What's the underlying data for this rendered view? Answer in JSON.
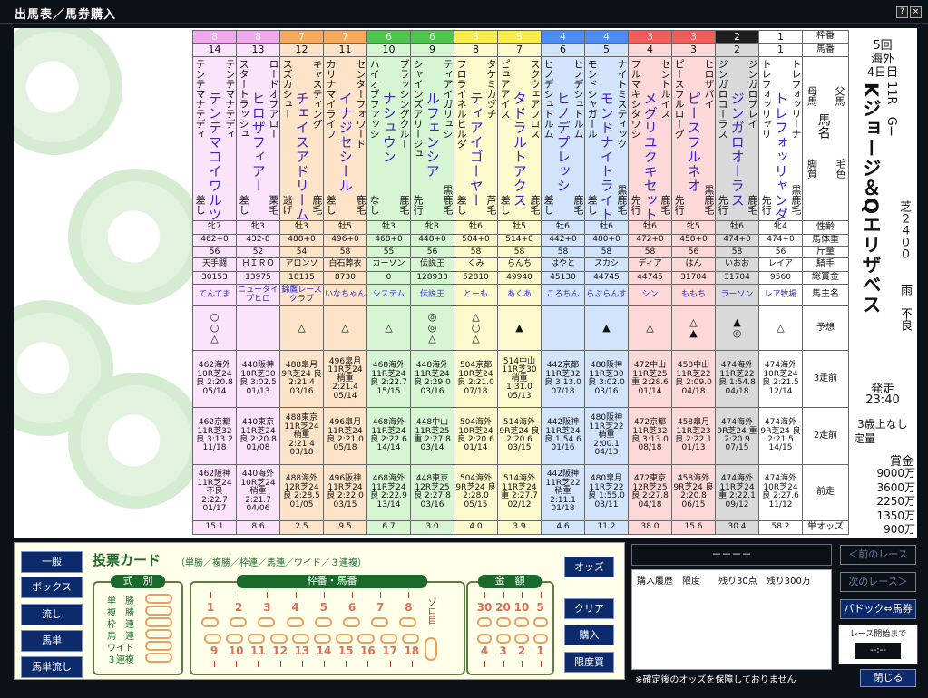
{
  "window": {
    "title": "出馬表／馬券購入",
    "help": "?",
    "close": "×"
  },
  "labels": {
    "waku": "枠番",
    "umaban": "馬番",
    "chichi": "父馬",
    "haha": "母馬",
    "bamei": "馬名",
    "kyakushitsu": "脚質",
    "keiro": "毛色",
    "seirei": "性齢",
    "bataiju": "馬体重",
    "kinryo": "斤量",
    "kishu": "騎手",
    "soushokin": "総賞金",
    "umanushi": "馬主名",
    "yoso": "予想",
    "s3": "3走前",
    "s2": "2走前",
    "s1": "前走",
    "odds": "単オッズ"
  },
  "horses": [
    {
      "waku": "8",
      "umaban": "14",
      "sire": "テンテマナテディ",
      "dam": "テンテマナテディ",
      "name": "テンテマコイワルツ",
      "style": "差し",
      "color": "",
      "sex": "牝7",
      "weight": "462+0",
      "kin": "56",
      "jockey": "天手闘",
      "prize": "30153",
      "owner": "てんてま",
      "m": "○\n○\n△",
      "r3": "462海外\n10R芝24\n良\n2:20.8\n05/14",
      "r2": "462京都\n11R芝32\n良\n3:13.2\n11/18",
      "r1": "462阪神\n11R芝24\n不良\n2:22.7\n01/17",
      "odds": "15.1"
    },
    {
      "waku": "8",
      "umaban": "13",
      "sire": "ロードオブアロー",
      "dam": "スタートラッシュ",
      "name": "ヒロザフィアー",
      "style": "差し",
      "color": "栗毛",
      "sex": "牝3",
      "weight": "432-8",
      "kin": "52",
      "jockey": "ＨＩＲＯ",
      "prize": "13975",
      "owner": "ニュータイプヒロ",
      "m": "",
      "r3": "440阪神\n10R芝30\n良\n3:02.5\n01/13",
      "r2": "440東京\n11R芝24\n良\n2:20.8\n01/08",
      "r1": "440海外\n10R芝24\n稍重\n2:21.7\n04/06",
      "odds": "8.6"
    },
    {
      "waku": "7",
      "umaban": "12",
      "sire": "キャスティング",
      "dam": "スズカシュー",
      "name": "チェイスアドリーム",
      "style": "逃げ",
      "color": "鹿毛",
      "sex": "牡3",
      "weight": "488+0",
      "kin": "54",
      "jockey": "アロンソ",
      "prize": "18115",
      "owner": "錦鷹レースクラブ",
      "m": "△",
      "r3": "488皐月\n9R芝24\n良\n2:21.4\n03/16",
      "r2": "488東京\n11R芝24\n稍重\n2:21.4\n03/18",
      "r1": "488海外\n12R芝24\n良\n2:28.5\n01/05",
      "odds": "2.5"
    },
    {
      "waku": "7",
      "umaban": "11",
      "sire": "センターフォワード",
      "dam": "カリナマイライフ",
      "name": "イナジセシール",
      "style": "差し",
      "color": "鹿毛",
      "sex": "牡5",
      "weight": "496+0",
      "kin": "58",
      "jockey": "白石葬衣",
      "prize": "8730",
      "owner": "いなちゃん",
      "m": "△",
      "r3": "496皐月\n11R芝24\n稍重\n2:21.4\n05/14",
      "r2": "496皐月\n11R芝24\n良\n2:21.0\n05/18",
      "r1": "496阪神\n11R芝24\n良\n2:22.0\n03/15",
      "odds": "9.5"
    },
    {
      "waku": "6",
      "umaban": "10",
      "sire": "ブラッシングクルー",
      "dam": "ハイオブファッシ",
      "name": "ナシュウン",
      "style": "なし",
      "color": "鹿毛",
      "sex": "牡3",
      "weight": "468+0",
      "kin": "55",
      "jockey": "カーソン",
      "prize": "0",
      "owner": "システム",
      "m": "△",
      "r3": "468海外\n11R芝24\n良\n2:22.7\n15/15",
      "r2": "468海外\n11R芝24\n良\n2:22.6\n14/14",
      "r1": "468海外\n11R芝24\n良\n2:22.9\n13/14",
      "odds": "6.7"
    },
    {
      "waku": "6",
      "umaban": "9",
      "sire": "ティアイガリュシ",
      "dam": "シャインズアリージュ",
      "name": "ルフェンシア",
      "style": "先行",
      "color": "黒鹿毛",
      "sex": "牝8",
      "weight": "448+0",
      "kin": "56",
      "jockey": "伝説王",
      "prize": "128933",
      "owner": "伝説王",
      "m": "◎\n◎\n△",
      "r3": "448海外\n11R芝24\n良\n2:29.0\n03/16",
      "r2": "448中山\n11R芝25\n重\n2:27.8\n03/14",
      "r1": "448東京\n12R芝25\n良\n2:27.8\n03/16",
      "odds": "3.0"
    },
    {
      "waku": "5",
      "umaban": "8",
      "sire": "タケミカヅチ",
      "dam": "フロライネルヒルダ",
      "name": "ティアイゴーヤー",
      "style": "差し",
      "color": "芦毛",
      "sex": "牡6",
      "weight": "504+0",
      "kin": "58",
      "jockey": "くみ",
      "prize": "52810",
      "owner": "とーも",
      "m": "△\n○\n△",
      "r3": "504京都\n10R芝24\n良\n2:21.0\n07/18",
      "r2": "504海外\n10R芝24\n良\n2:20.6\n01/14",
      "r1": "504海外\n9R芝24\n良\n2:28.0\n05/15",
      "odds": "4.0"
    },
    {
      "waku": "5",
      "umaban": "7",
      "sire": "スクウェアフロス",
      "dam": "ピュアアイス",
      "name": "タドラルトアクス",
      "style": "差し",
      "color": "鹿毛",
      "sex": "牡5",
      "weight": "514+0",
      "kin": "58",
      "jockey": "らんち",
      "prize": "49940",
      "owner": "あくあ",
      "m": "▲",
      "r3": "514中山\n11R芝30\n稍重\n1:31.0\n05/13",
      "r2": "514海外\n9R芝24\n良\n2:20.6\n03/15",
      "r1": "514海外\n11R芝24\n重\n2:27.7\n02/12",
      "odds": "3.9"
    },
    {
      "waku": "4",
      "umaban": "6",
      "sire": "ヒノデシュトルム",
      "dam": "ヒノデシュトルム",
      "name": "ヒノデプレッシ",
      "style": "差し",
      "color": "鹿毛",
      "sex": "牡6",
      "weight": "442+0",
      "kin": "58",
      "jockey": "はやと",
      "prize": "45130",
      "owner": "ころちん",
      "m": "",
      "r3": "442京都\n11R芝32\n良\n3:13.0\n07/18",
      "r2": "442阪神\n11R芝24\n良\n1:54.6\n01/16",
      "r1": "442阪神\n11R芝22\n稍重\n2:11.1\n01/18",
      "odds": "4.6"
    },
    {
      "waku": "4",
      "umaban": "5",
      "sire": "ナイトミスティック",
      "dam": "モンドシャガール",
      "name": "モンドナイトライト",
      "style": "差し",
      "color": "黒鹿毛",
      "sex": "牡6",
      "weight": "480+0",
      "kin": "58",
      "jockey": "スカシ",
      "prize": "44745",
      "owner": "らぶらんす",
      "m": "▲",
      "r3": "480阪神\n11R芝30\n良\n3:02.0\n03/16",
      "r2": "480阪神\n11R芝22\n稍重\n2:00.1\n04/13",
      "r1": "480皐月\n11R芝22\n良\n1:55.0\n03/11",
      "odds": "11.2"
    },
    {
      "waku": "3",
      "umaban": "4",
      "sire": "セントルイス",
      "dam": "フルマキシタワシ",
      "name": "メグリユクキセット",
      "style": "先行",
      "color": "鹿毛",
      "sex": "牡6",
      "weight": "472+0",
      "kin": "58",
      "jockey": "ディア",
      "prize": "44745",
      "owner": "シン",
      "m": "△",
      "r3": "472中山\n11R芝25\n重\n2:28.6\n01/14",
      "r2": "472京都\n11R芝32\n良\n3:13.0\n08/18",
      "r1": "472東京\n12R芝25\n良\n2:27.8\n04/18",
      "odds": "38.0"
    },
    {
      "waku": "3",
      "umaban": "3",
      "sire": "ヒロザバイ",
      "dam": "ピースフルローグ",
      "name": "ピースフルネオ",
      "style": "先行",
      "color": "黒鹿毛",
      "sex": "牝5",
      "weight": "458+0",
      "kin": "56",
      "jockey": "はん",
      "prize": "31704",
      "owner": "ももち",
      "m": "△\n▲",
      "r3": "458中山\n11R芝22\n良\n2:09.0\n04/18",
      "r2": "458皐月\n11R芝23\n良\n2:22.1\n01/13",
      "r1": "458海外\n9R芝24\n良\n2:20.8\n06/15",
      "odds": "15.6"
    },
    {
      "waku": "2",
      "umaban": "2",
      "sire": "ジンガロプレイ",
      "dam": "ジンガロコーラス",
      "name": "ジンガロオーラス",
      "style": "先行",
      "color": "鹿毛",
      "sex": "牡6",
      "weight": "474+0",
      "kin": "58",
      "jockey": "いおお",
      "prize": "31704",
      "owner": "ラーソン",
      "m": "▲\n◎",
      "r3": "474海外\n11R芝22\n良\n1:54.8\n04/18",
      "r2": "474海外\n9R芝24\n重\n2:20.9\n07/15",
      "r1": "474海外\n11R芝24\n重\n2:22.1\n09/12",
      "odds": "30.4"
    },
    {
      "waku": "1",
      "umaban": "1",
      "sire": "トレフォッリーナ",
      "dam": "トレフォッリャリ",
      "name": "トレフォッリャンダ",
      "style": "先行",
      "color": "黒鹿毛",
      "sex": "牝4",
      "weight": "474+0",
      "kin": "56",
      "jockey": "レイア",
      "prize": "9560",
      "owner": "レア牧場",
      "m": "△",
      "r3": "474海外\n10R芝24\n良\n2:21.5\n12/14",
      "r2": "474海外\n9R芝24\n良\n2:21.5\n14/15",
      "r1": "474海外\n10R芝24\n良\n2:27.6\n11/12",
      "odds": "58.2"
    }
  ],
  "race": {
    "kai": "5回",
    "place": "海外",
    "day": "4日目",
    "rnum": "11R",
    "grade": "GⅠ",
    "name": "Kジョージ＆Qエリザベス",
    "course": "芝２４００",
    "weather": "雨",
    "baba": "不良",
    "start_label": "発走",
    "start": "23:40",
    "cond": "3歳上なし",
    "cond2": "定量",
    "prize_label": "賞金",
    "prizes": [
      "9000万",
      "3600万",
      "2250万",
      "1350万",
      "900万"
    ]
  },
  "buy": {
    "title": "投票カード",
    "subtitle": "（単勝／複勝／枠連／馬連／ワイド／３連複）",
    "shiki_label": "式　別",
    "shiki": [
      "単　勝",
      "複　勝",
      "枠　連",
      "馬　連",
      "ワイド",
      "３連複"
    ],
    "umaban_label": "枠番・馬番",
    "nums_top": [
      "1",
      "2",
      "3",
      "4",
      "5",
      "6",
      "7",
      "8"
    ],
    "nums_bottom": [
      "9",
      "10",
      "11",
      "12",
      "13",
      "14",
      "15",
      "16",
      "17",
      "18"
    ],
    "zoro": "ゾロ目",
    "kingaku_label": "金　額",
    "amounts_top": [
      "30",
      "20",
      "10",
      "5"
    ],
    "amounts_bottom": [
      "4",
      "3",
      "2",
      "1"
    ],
    "odds_btn": "オッズ",
    "clear_btn": "クリア",
    "buy_btn": "購入",
    "limit_btn": "限度買"
  },
  "leftbtns": [
    "一般",
    "ボックス",
    "流し",
    "馬単",
    "馬単流し"
  ],
  "history": {
    "bar": "－－－－",
    "head": "購入履歴　限度　　残り30点　残り300万",
    "note": "※確定後のオッズを保障しておりません"
  },
  "nav": {
    "prev": "＜前のレース",
    "next": "次のレース＞",
    "paddock": "パドック⇔馬券",
    "until_label": "レース開始まで",
    "until": "--:--",
    "close": "閉じる"
  },
  "colors": {
    "w8": "#f0a8ec",
    "w7": "#f5a95c",
    "w6": "#4ec54d",
    "w5": "#f7ed4d",
    "w4": "#4d8cf2",
    "w3": "#ef5d5d",
    "w2": "#1e1e1e",
    "w1": "#ffffff"
  }
}
